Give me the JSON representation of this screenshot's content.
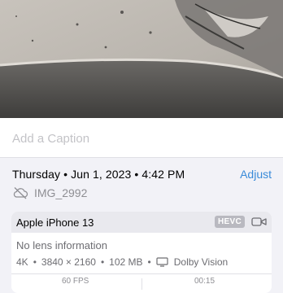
{
  "caption": {
    "placeholder": "Add a Caption"
  },
  "details": {
    "datetime": "Thursday • Jun 1, 2023 • 4:42 PM",
    "adjust_label": "Adjust",
    "filename": "IMG_2992",
    "cloud_icon": "cloud-slash-icon"
  },
  "camera": {
    "device": "Apple iPhone 13",
    "format_badge": "HEVC",
    "video_icon": "video-camera-icon",
    "lens": "No lens information",
    "specs": {
      "resolution_label": "4K",
      "dimensions": "3840 × 2160",
      "size": "102 MB",
      "display_icon": "display-icon",
      "hdr": "Dolby Vision"
    },
    "stats": {
      "frame_rate": "60 FPS",
      "duration": "00:15"
    }
  },
  "colors": {
    "accent": "#3a8bd9",
    "secondary_text": "#8e8e93",
    "background": "#f2f2f7"
  }
}
